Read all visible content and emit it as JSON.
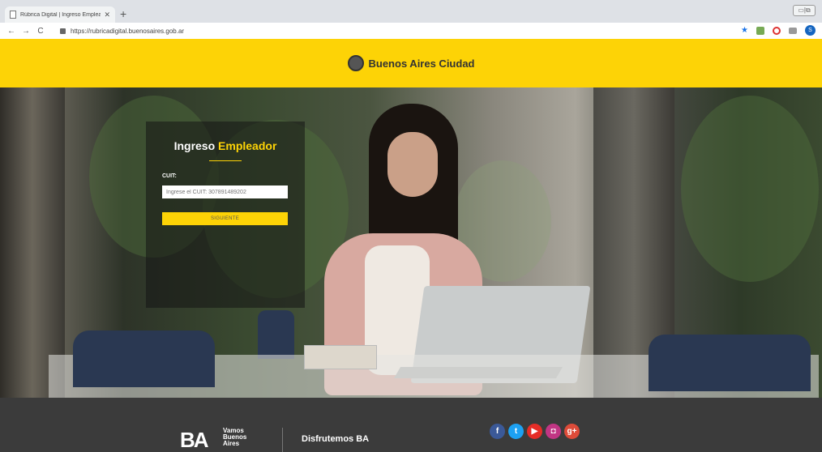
{
  "browser": {
    "tab_title": "Rúbrica Digital | Ingreso Emplea...",
    "url": "https://rubricadigital.buenosaires.gob.ar",
    "profile_initial": "S"
  },
  "header": {
    "brand": "Buenos Aires Ciudad"
  },
  "login": {
    "title_white": "Ingreso",
    "title_yellow": "Empleador",
    "cuit_label": "CUIT:",
    "cuit_placeholder": "Ingrese el CUIT: 307891489202",
    "next_button": "SIGUIENTE"
  },
  "footer": {
    "ba_logo": "BA",
    "ba_line1": "Vamos",
    "ba_line2": "Buenos",
    "ba_line3": "Aires",
    "tagline": "Disfrutemos BA",
    "social": [
      {
        "name": "facebook-icon",
        "glyph": "f",
        "color": "#3b5998"
      },
      {
        "name": "twitter-icon",
        "glyph": "t",
        "color": "#1da1f2"
      },
      {
        "name": "youtube-icon",
        "glyph": "▶",
        "color": "#e52d27"
      },
      {
        "name": "instagram-icon",
        "glyph": "◘",
        "color": "#c13584"
      },
      {
        "name": "googleplus-icon",
        "glyph": "g+",
        "color": "#dd4b39"
      }
    ]
  },
  "colors": {
    "accent": "#fdd306",
    "footer_bg": "#3b3b3b"
  }
}
